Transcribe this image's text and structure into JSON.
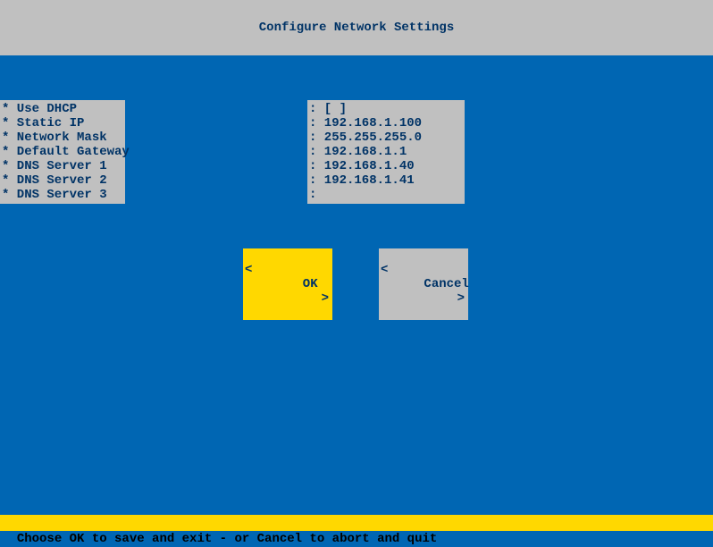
{
  "header": {
    "title": "Configure Network Settings"
  },
  "fields": {
    "labels": [
      "* Use DHCP",
      "* Static IP",
      "* Network Mask",
      "* Default Gateway",
      "* DNS Server 1",
      "* DNS Server 2",
      "* DNS Server 3"
    ],
    "values": [
      ": [ ]",
      ": 192.168.1.100",
      ": 255.255.255.0",
      ": 192.168.1.1",
      ": 192.168.1.40",
      ": 192.168.1.41",
      ":"
    ]
  },
  "buttons": {
    "ok": "OK",
    "cancel": "Cancel"
  },
  "footer": {
    "text": "Choose OK to save and exit - or Cancel to abort and quit"
  }
}
